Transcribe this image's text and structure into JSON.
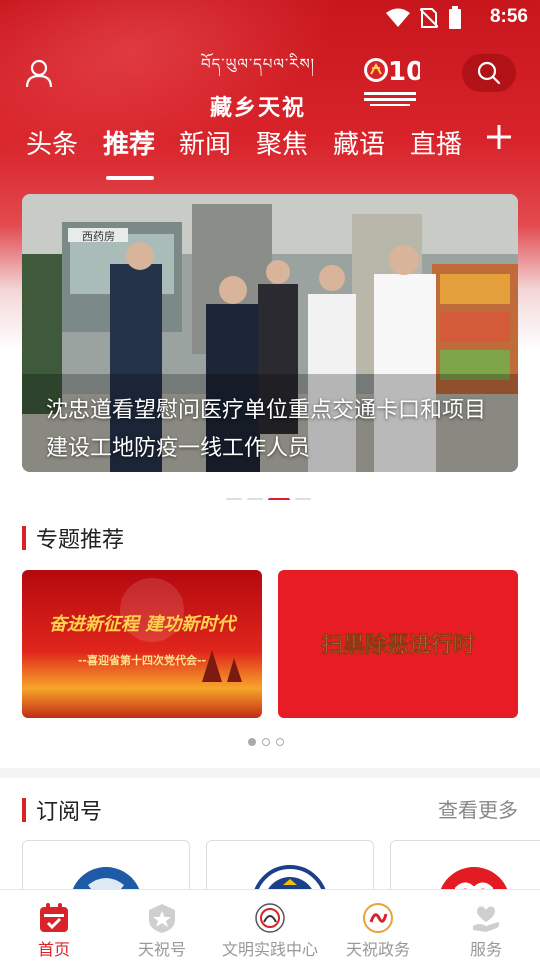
{
  "status_bar": {
    "time": "8:56"
  },
  "header": {
    "logo_tibetan": "བོད་ཡུལ་དཔལ་རིས།",
    "logo_main": "藏乡天祝",
    "badge_number": "100"
  },
  "tabs": [
    {
      "label": "头条"
    },
    {
      "label": "推荐",
      "active": true
    },
    {
      "label": "新闻"
    },
    {
      "label": "聚焦"
    },
    {
      "label": "藏语"
    },
    {
      "label": "直播"
    }
  ],
  "hero": {
    "caption": "沈忠道看望慰问医疗单位重点交通卡口和项目建设工地防疫一线工作人员",
    "sign_text": "西药房",
    "slide_index": 3,
    "slide_count": 4
  },
  "topics": {
    "title": "专题推荐",
    "cards": [
      {
        "headline": "奋进新征程 建功新时代",
        "subline": "--喜迎省第十四次党代会--"
      },
      {
        "headline": "扫黑除恶进行时"
      }
    ],
    "page_index": 1,
    "page_count": 3
  },
  "subscriptions": {
    "title": "订阅号",
    "more_label": "查看更多"
  },
  "tabbar": [
    {
      "label": "首页",
      "icon": "calendar-icon",
      "active": true
    },
    {
      "label": "天祝号",
      "icon": "star-shield-icon"
    },
    {
      "label": "文明实践中心",
      "icon": "emblem-icon"
    },
    {
      "label": "天祝政务",
      "icon": "gov-seal-icon"
    },
    {
      "label": "服务",
      "icon": "heart-hand-icon"
    }
  ],
  "colors": {
    "brand_red": "#d8232a",
    "inactive_gray": "#999999"
  }
}
